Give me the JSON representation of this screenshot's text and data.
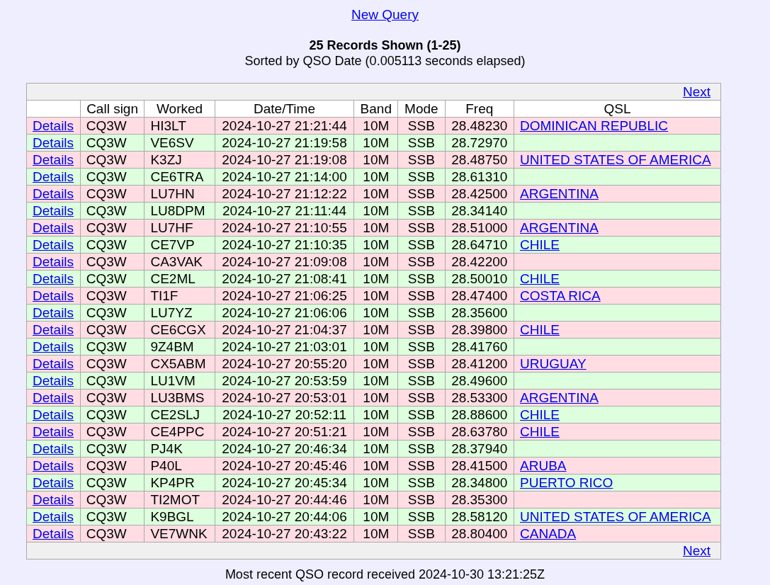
{
  "new_query_link": "New Query",
  "title": "25 Records Shown (1-25)",
  "subtitle": "Sorted by QSO Date (0.005113 seconds elapsed)",
  "pager_top": {
    "next": "Next"
  },
  "columns": [
    "Call sign",
    "Worked",
    "Date/Time",
    "Band",
    "Mode",
    "Freq",
    "QSL"
  ],
  "rows": [
    {
      "details": "Details",
      "call_sign": "CQ3W",
      "worked": "HI3LT",
      "datetime": "2024-10-27 21:21:44",
      "band": "10M",
      "mode": "SSB",
      "freq": "28.48230",
      "qsl": "DOMINICAN REPUBLIC"
    },
    {
      "details": "Details",
      "call_sign": "CQ3W",
      "worked": "VE6SV",
      "datetime": "2024-10-27 21:19:58",
      "band": "10M",
      "mode": "SSB",
      "freq": "28.72970"
    },
    {
      "details": "Details",
      "call_sign": "CQ3W",
      "worked": "K3ZJ",
      "datetime": "2024-10-27 21:19:08",
      "band": "10M",
      "mode": "SSB",
      "freq": "28.48750",
      "qsl": "UNITED STATES OF AMERICA"
    },
    {
      "details": "Details",
      "call_sign": "CQ3W",
      "worked": "CE6TRA",
      "datetime": "2024-10-27 21:14:00",
      "band": "10M",
      "mode": "SSB",
      "freq": "28.61310"
    },
    {
      "details": "Details",
      "call_sign": "CQ3W",
      "worked": "LU7HN",
      "datetime": "2024-10-27 21:12:22",
      "band": "10M",
      "mode": "SSB",
      "freq": "28.42500",
      "qsl": "ARGENTINA"
    },
    {
      "details": "Details",
      "call_sign": "CQ3W",
      "worked": "LU8DPM",
      "datetime": "2024-10-27 21:11:44",
      "band": "10M",
      "mode": "SSB",
      "freq": "28.34140"
    },
    {
      "details": "Details",
      "call_sign": "CQ3W",
      "worked": "LU7HF",
      "datetime": "2024-10-27 21:10:55",
      "band": "10M",
      "mode": "SSB",
      "freq": "28.51000",
      "qsl": "ARGENTINA"
    },
    {
      "details": "Details",
      "call_sign": "CQ3W",
      "worked": "CE7VP",
      "datetime": "2024-10-27 21:10:35",
      "band": "10M",
      "mode": "SSB",
      "freq": "28.64710",
      "qsl": "CHILE"
    },
    {
      "details": "Details",
      "call_sign": "CQ3W",
      "worked": "CA3VAK",
      "datetime": "2024-10-27 21:09:08",
      "band": "10M",
      "mode": "SSB",
      "freq": "28.42200"
    },
    {
      "details": "Details",
      "call_sign": "CQ3W",
      "worked": "CE2ML",
      "datetime": "2024-10-27 21:08:41",
      "band": "10M",
      "mode": "SSB",
      "freq": "28.50010",
      "qsl": "CHILE"
    },
    {
      "details": "Details",
      "call_sign": "CQ3W",
      "worked": "TI1F",
      "datetime": "2024-10-27 21:06:25",
      "band": "10M",
      "mode": "SSB",
      "freq": "28.47400",
      "qsl": "COSTA RICA"
    },
    {
      "details": "Details",
      "call_sign": "CQ3W",
      "worked": "LU7YZ",
      "datetime": "2024-10-27 21:06:06",
      "band": "10M",
      "mode": "SSB",
      "freq": "28.35600"
    },
    {
      "details": "Details",
      "call_sign": "CQ3W",
      "worked": "CE6CGX",
      "datetime": "2024-10-27 21:04:37",
      "band": "10M",
      "mode": "SSB",
      "freq": "28.39800",
      "qsl": "CHILE"
    },
    {
      "details": "Details",
      "call_sign": "CQ3W",
      "worked": "9Z4BM",
      "datetime": "2024-10-27 21:03:01",
      "band": "10M",
      "mode": "SSB",
      "freq": "28.41760"
    },
    {
      "details": "Details",
      "call_sign": "CQ3W",
      "worked": "CX5ABM",
      "datetime": "2024-10-27 20:55:20",
      "band": "10M",
      "mode": "SSB",
      "freq": "28.41200",
      "qsl": "URUGUAY"
    },
    {
      "details": "Details",
      "call_sign": "CQ3W",
      "worked": "LU1VM",
      "datetime": "2024-10-27 20:53:59",
      "band": "10M",
      "mode": "SSB",
      "freq": "28.49600"
    },
    {
      "details": "Details",
      "call_sign": "CQ3W",
      "worked": "LU3BMS",
      "datetime": "2024-10-27 20:53:01",
      "band": "10M",
      "mode": "SSB",
      "freq": "28.53300",
      "qsl": "ARGENTINA"
    },
    {
      "details": "Details",
      "call_sign": "CQ3W",
      "worked": "CE2SLJ",
      "datetime": "2024-10-27 20:52:11",
      "band": "10M",
      "mode": "SSB",
      "freq": "28.88600",
      "qsl": "CHILE"
    },
    {
      "details": "Details",
      "call_sign": "CQ3W",
      "worked": "CE4PPC",
      "datetime": "2024-10-27 20:51:21",
      "band": "10M",
      "mode": "SSB",
      "freq": "28.63780",
      "qsl": "CHILE"
    },
    {
      "details": "Details",
      "call_sign": "CQ3W",
      "worked": "PJ4K",
      "datetime": "2024-10-27 20:46:34",
      "band": "10M",
      "mode": "SSB",
      "freq": "28.37940"
    },
    {
      "details": "Details",
      "call_sign": "CQ3W",
      "worked": "P40L",
      "datetime": "2024-10-27 20:45:46",
      "band": "10M",
      "mode": "SSB",
      "freq": "28.41500",
      "qsl": "ARUBA"
    },
    {
      "details": "Details",
      "call_sign": "CQ3W",
      "worked": "KP4PR",
      "datetime": "2024-10-27 20:45:34",
      "band": "10M",
      "mode": "SSB",
      "freq": "28.34800",
      "qsl": "PUERTO RICO"
    },
    {
      "details": "Details",
      "call_sign": "CQ3W",
      "worked": "TI2MOT",
      "datetime": "2024-10-27 20:44:46",
      "band": "10M",
      "mode": "SSB",
      "freq": "28.35300"
    },
    {
      "details": "Details",
      "call_sign": "CQ3W",
      "worked": "K9BGL",
      "datetime": "2024-10-27 20:44:06",
      "band": "10M",
      "mode": "SSB",
      "freq": "28.58120",
      "qsl": "UNITED STATES OF AMERICA"
    },
    {
      "details": "Details",
      "call_sign": "CQ3W",
      "worked": "VE7WNK",
      "datetime": "2024-10-27 20:43:22",
      "band": "10M",
      "mode": "SSB",
      "freq": "28.80400",
      "qsl": "CANADA"
    }
  ],
  "pager_bottom": {
    "next": "Next"
  },
  "footer": "Most recent QSO record received 2024-10-30 13:21:25Z"
}
